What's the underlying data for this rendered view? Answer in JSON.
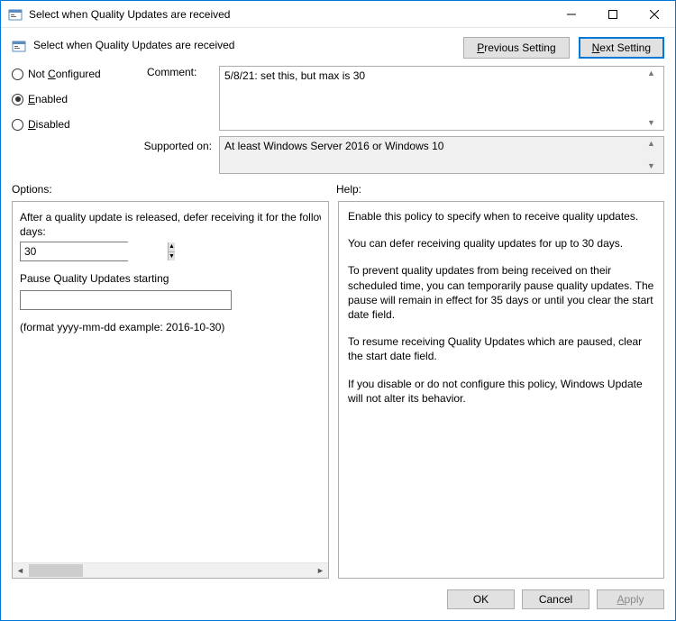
{
  "titlebar": {
    "text": "Select when Quality Updates are received"
  },
  "header": {
    "title": "Select when Quality Updates are received",
    "prev_label": "Previous Setting",
    "next_label": "Next Setting"
  },
  "radio": {
    "not_configured": "Not Configured",
    "enabled": "Enabled",
    "disabled": "Disabled",
    "selected": "enabled"
  },
  "comment": {
    "label": "Comment:",
    "value": "5/8/21: set this, but max is 30"
  },
  "supported": {
    "label": "Supported on:",
    "value": "At least Windows Server 2016 or Windows 10"
  },
  "panels": {
    "options_label": "Options:",
    "help_label": "Help:"
  },
  "options": {
    "defer_label": "After a quality update is released, defer receiving it for the following number of days:",
    "defer_value": "30",
    "pause_label": "Pause Quality Updates starting",
    "pause_value": "",
    "format_hint": "(format yyyy-mm-dd example: 2016-10-30)"
  },
  "help": {
    "p1": "Enable this policy to specify when to receive quality updates.",
    "p2": "You can defer receiving quality updates for up to 30 days.",
    "p3": "To prevent quality updates from being received on their scheduled time, you can temporarily pause quality updates. The pause will remain in effect for 35 days or until you clear the start date field.",
    "p4": "To resume receiving Quality Updates which are paused, clear the start date field.",
    "p5": "If you disable or do not configure this policy, Windows Update will not alter its behavior."
  },
  "footer": {
    "ok": "OK",
    "cancel": "Cancel",
    "apply": "Apply"
  }
}
